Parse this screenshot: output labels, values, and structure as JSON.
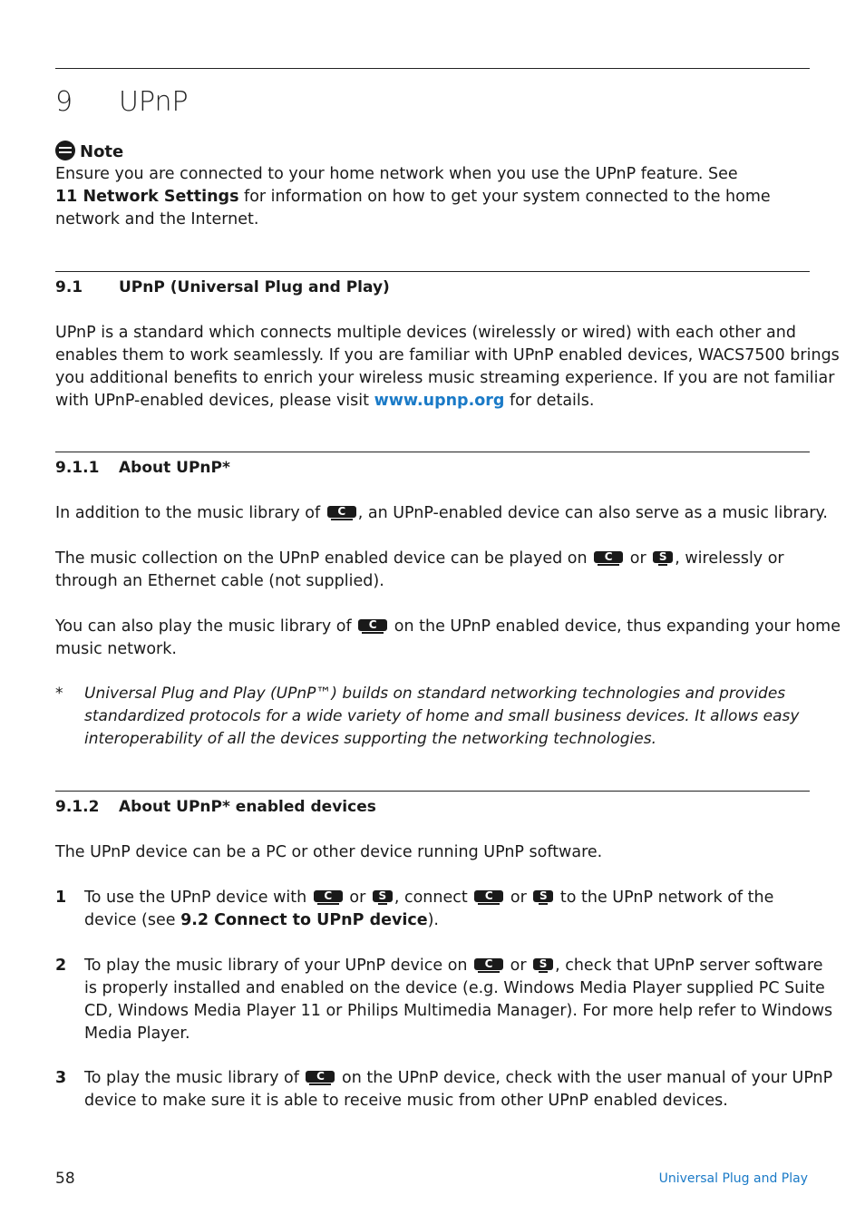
{
  "chapter": {
    "number": "9",
    "title": "UPnP"
  },
  "note": {
    "label": "Note",
    "line1": "Ensure you are connected to your home network when you use the UPnP feature. See",
    "ref": "11 Network Settings",
    "line2": " for information on how to get your system connected to the home",
    "line3": "network and the Internet."
  },
  "s91": {
    "number": "9.1",
    "title": "UPnP (Universal Plug and Play)",
    "lines": [
      "UPnP is a standard which connects multiple devices (wirelessly or wired) with each other and",
      "enables them to work seamlessly. If you are familiar with UPnP enabled devices, WACS7500 brings",
      "you additional benefits to enrich your wireless music streaming experience. If you are not familiar"
    ],
    "last_pre": "with UPnP-enabled devices, please visit ",
    "link": "www.upnp.org",
    "last_post": " for details."
  },
  "s911": {
    "number": "9.1.1",
    "title": "About UPnP*",
    "p1_pre": "In addition to the music library of ",
    "p1_post": ", an UPnP-enabled device can also serve as a music library.",
    "p2_pre": "The music collection on the UPnP enabled device can be played on ",
    "or": " or ",
    "p2_post": ", wirelessly or",
    "p2_line2": "through an Ethernet cable (not supplied).",
    "p3_pre": "You can also play the music library of ",
    "p3_post": " on the UPnP enabled device, thus expanding your home",
    "p3_line2": "music network.",
    "footnote_mark": "*",
    "footnote": [
      "Universal Plug and Play (UPnP™) builds on standard networking technologies and provides",
      "standardized protocols for a wide variety of home and small business devices. It allows easy",
      "interoperability of all the devices supporting the networking technologies."
    ]
  },
  "s912": {
    "number": "9.1.2",
    "title": "About UPnP* enabled devices",
    "intro": "The UPnP device can be a PC or other device running UPnP software.",
    "steps": [
      {
        "n": "1",
        "a": "To use the UPnP device with ",
        "b": " or ",
        "c": ", connect ",
        "d": " or ",
        "e": " to the UPnP network of the",
        "l2_pre": "device (see ",
        "l2_ref": "9.2 Connect to UPnP device",
        "l2_post": ")."
      },
      {
        "n": "2",
        "a": "To play the music library of your UPnP device on ",
        "b": " or ",
        "c": ", check that UPnP server software",
        "lines": [
          "is properly installed and enabled on the device (e.g. Windows Media Player supplied PC Suite",
          "CD, Windows Media Player 11 or Philips Multimedia Manager). For more help refer to Windows",
          "Media Player."
        ]
      },
      {
        "n": "3",
        "a": "To play the music library of ",
        "b": " on the UPnP device, check with the user manual of your UPnP",
        "l2": "device to make sure it is able to receive music from other UPnP enabled devices."
      }
    ]
  },
  "icons": {
    "center": "C",
    "station": "S"
  },
  "footer": {
    "page": "58",
    "title": "Universal Plug and Play"
  }
}
